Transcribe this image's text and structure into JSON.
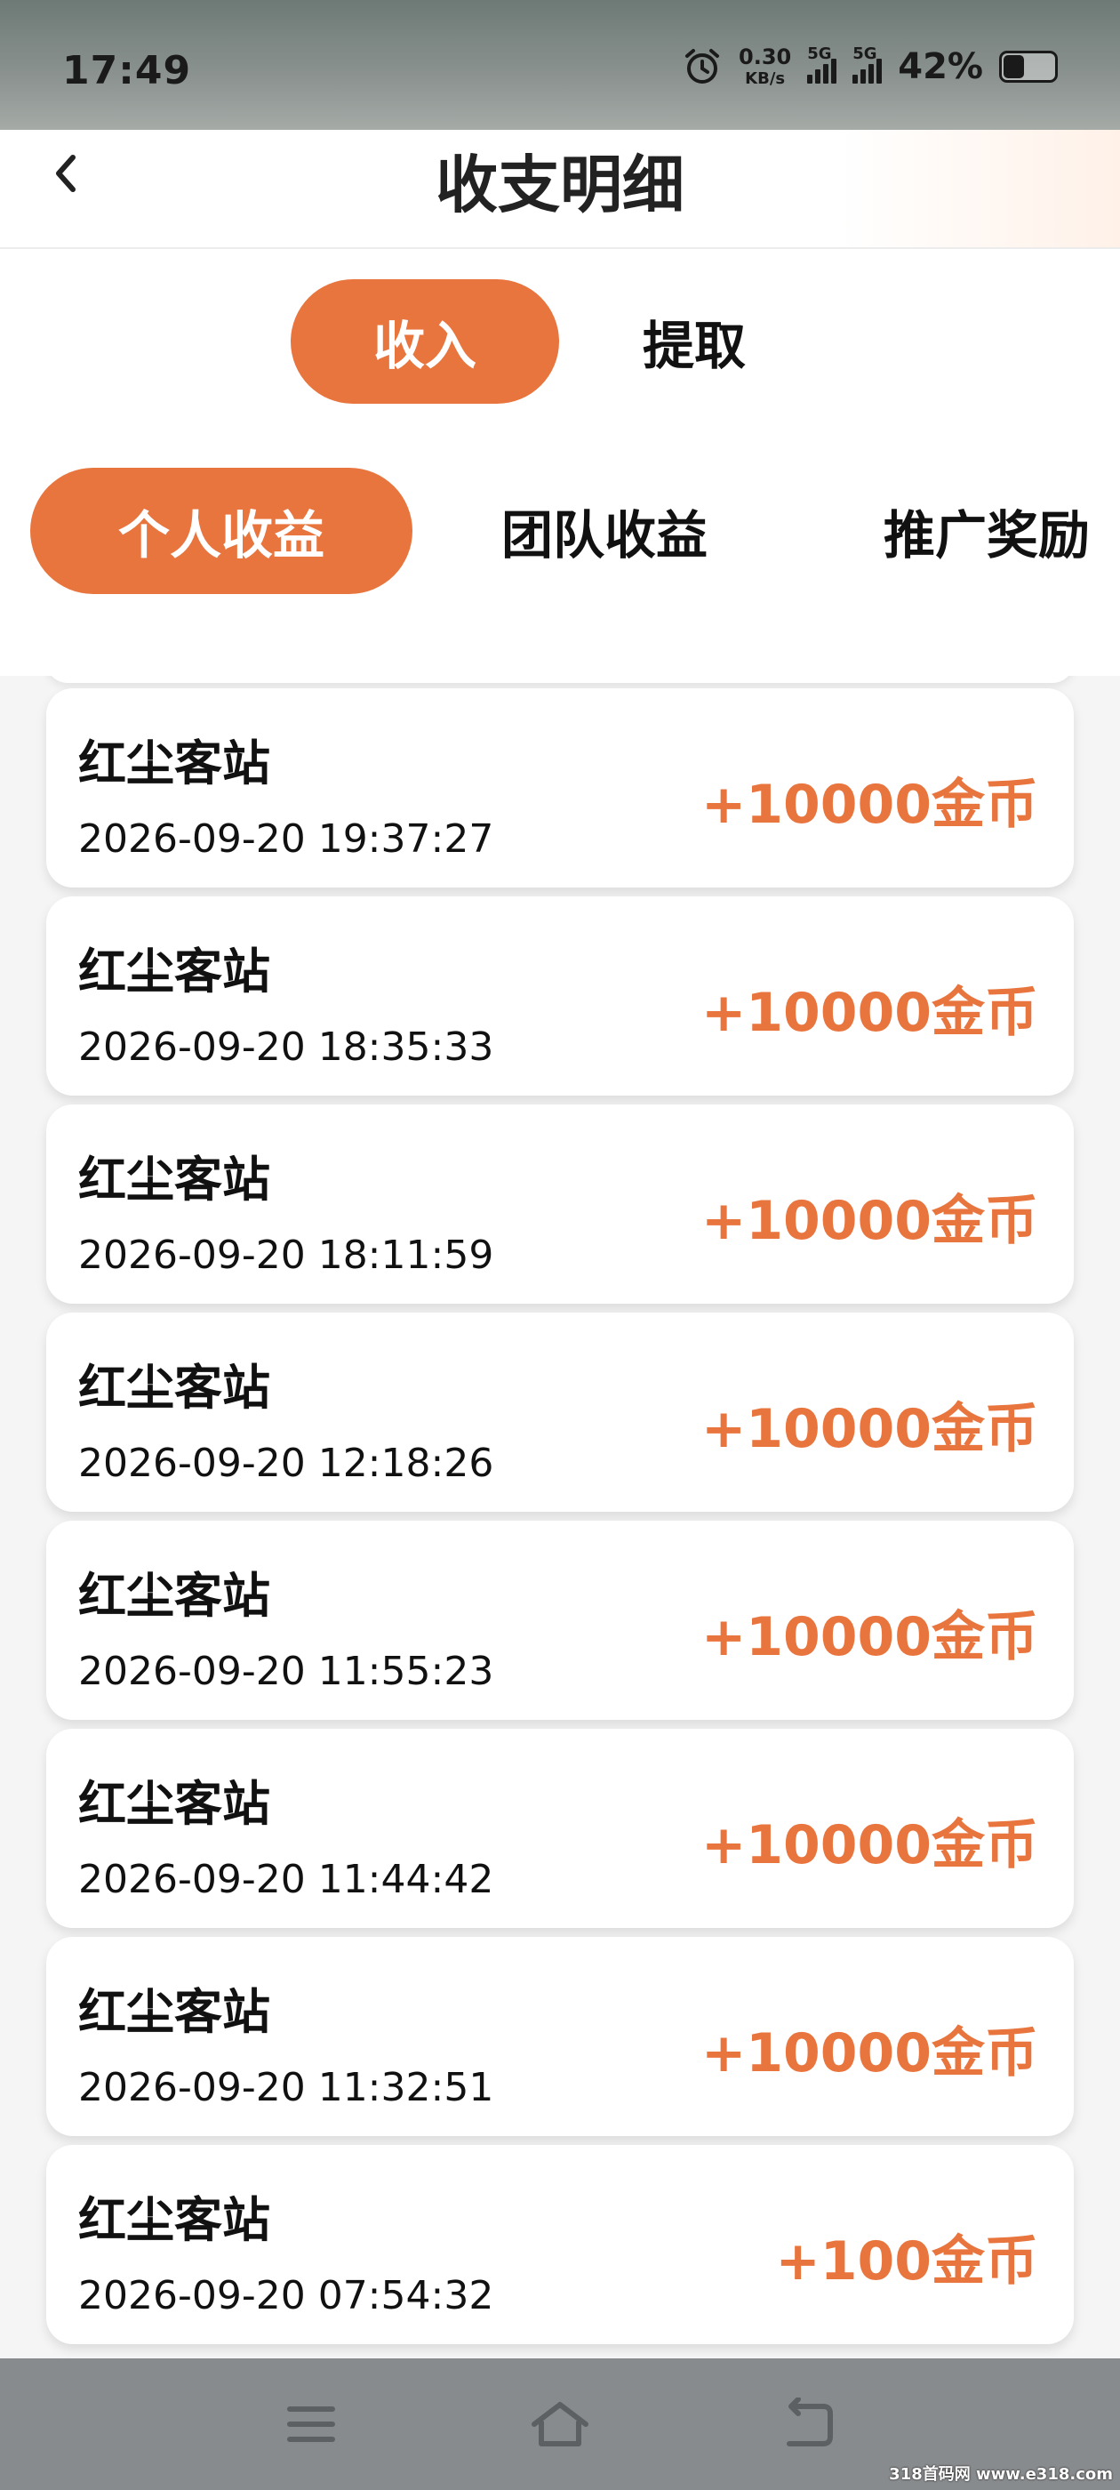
{
  "status_bar": {
    "time": "17:49",
    "net_speed_value": "0.30",
    "net_speed_unit": "KB/s",
    "sim1_label": "5G",
    "sim2_label": "5G",
    "battery_percent": "42%",
    "battery_level": 0.42
  },
  "header": {
    "title": "收支明细"
  },
  "primary_tabs": [
    {
      "label": "收入",
      "active": true
    },
    {
      "label": "提取",
      "active": false
    }
  ],
  "secondary_tabs": [
    {
      "label": "个人收益",
      "active": true
    },
    {
      "label": "团队收益",
      "active": false
    },
    {
      "label": "推广奖励",
      "active": false
    }
  ],
  "records": [
    {
      "name": "红尘客站",
      "time": "2026-09-20 19:37:27",
      "amount": "+10000金币"
    },
    {
      "name": "红尘客站",
      "time": "2026-09-20 18:35:33",
      "amount": "+10000金币"
    },
    {
      "name": "红尘客站",
      "time": "2026-09-20 18:11:59",
      "amount": "+10000金币"
    },
    {
      "name": "红尘客站",
      "time": "2026-09-20 12:18:26",
      "amount": "+10000金币"
    },
    {
      "name": "红尘客站",
      "time": "2026-09-20 11:55:23",
      "amount": "+10000金币"
    },
    {
      "name": "红尘客站",
      "time": "2026-09-20 11:44:42",
      "amount": "+10000金币"
    },
    {
      "name": "红尘客站",
      "time": "2026-09-20 11:32:51",
      "amount": "+10000金币"
    },
    {
      "name": "红尘客站",
      "time": "2026-09-20 07:54:32",
      "amount": "+100金币"
    }
  ],
  "colors": {
    "accent": "#e9753e",
    "background": "#f5f5f5",
    "card": "#ffffff"
  },
  "icons": {
    "back": "chevron-left-icon",
    "alarm": "alarm-clock-icon",
    "nav_menu": "menu-icon",
    "nav_home": "home-icon",
    "nav_back": "back-arrow-icon"
  },
  "watermark": "318首码网 www.e318.com"
}
